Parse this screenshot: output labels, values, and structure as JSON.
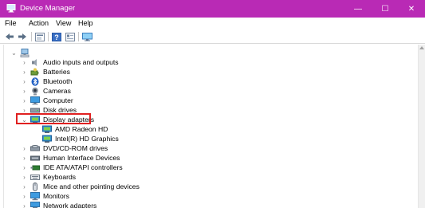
{
  "window": {
    "title": "Device Manager"
  },
  "window_controls": {
    "minimize": "—",
    "maximize": "☐",
    "close": "✕"
  },
  "menu": [
    "File",
    "Action",
    "View",
    "Help"
  ],
  "toolbar": {
    "icons": [
      "back-icon",
      "forward-icon",
      "properties-icon",
      "help-icon",
      "show-hidden-icon",
      "monitor-icon"
    ]
  },
  "tree": {
    "root_icon": "computer-icon",
    "categories": [
      {
        "label": "Audio inputs and outputs",
        "icon": "speaker-icon",
        "expanded": false
      },
      {
        "label": "Batteries",
        "icon": "battery-icon",
        "expanded": false
      },
      {
        "label": "Bluetooth",
        "icon": "bluetooth-icon",
        "expanded": false
      },
      {
        "label": "Cameras",
        "icon": "camera-icon",
        "expanded": false
      },
      {
        "label": "Computer",
        "icon": "monitor-icon",
        "expanded": false
      },
      {
        "label": "Disk drives",
        "icon": "disk-icon",
        "expanded": false
      },
      {
        "label": "Display adapters",
        "icon": "display-adapter-icon",
        "expanded": true,
        "highlighted": true,
        "children": [
          "AMD Radeon HD",
          "Intel(R) HD Graphics"
        ]
      },
      {
        "label": "DVD/CD-ROM drives",
        "icon": "dvd-icon",
        "expanded": false
      },
      {
        "label": "Human Interface Devices",
        "icon": "hid-icon",
        "expanded": false
      },
      {
        "label": "IDE ATA/ATAPI controllers",
        "icon": "ide-icon",
        "expanded": false
      },
      {
        "label": "Keyboards",
        "icon": "keyboard-icon",
        "expanded": false
      },
      {
        "label": "Mice and other pointing devices",
        "icon": "mouse-icon",
        "expanded": false
      },
      {
        "label": "Monitors",
        "icon": "monitor-icon",
        "expanded": false
      },
      {
        "label": "Network adapters",
        "icon": "network-icon",
        "expanded": false
      }
    ]
  },
  "colors": {
    "titlebar": "#b92ab5",
    "highlight_border": "#e02020"
  }
}
